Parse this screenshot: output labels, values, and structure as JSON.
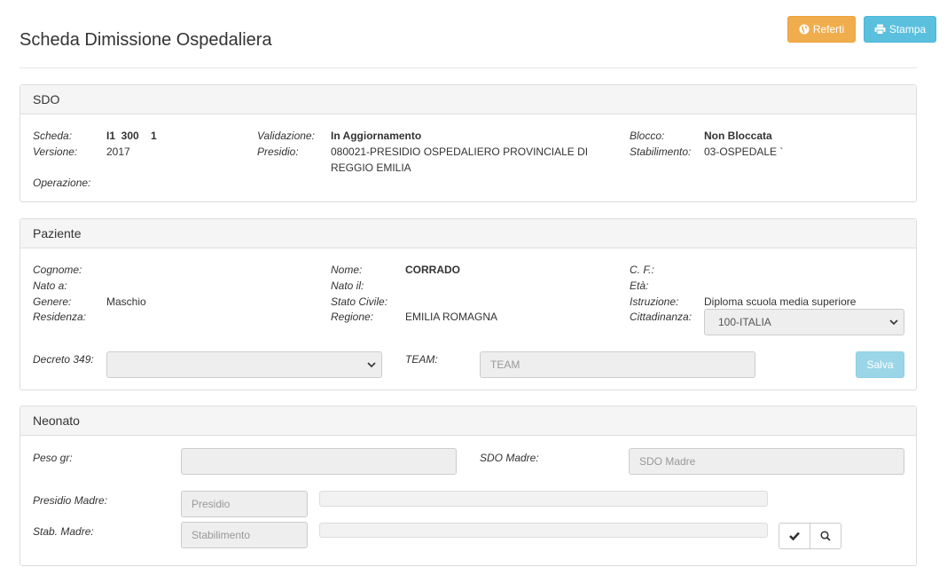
{
  "page": {
    "title": "Scheda Dimissione Ospedaliera"
  },
  "toolbar": {
    "referti_label": "Referti",
    "stampa_label": "Stampa"
  },
  "sdo": {
    "header": "SDO",
    "scheda_label": "Scheda:",
    "scheda_value": "I1  300    1",
    "versione_label": "Versione:",
    "versione_value": "2017",
    "operazione_label": "Operazione:",
    "validazione_label": "Validazione:",
    "validazione_value": "In Aggiornamento",
    "presidio_label": "Presidio:",
    "presidio_value_line1": "080021-PRESIDIO OSPEDALIERO PROVINCIALE DI",
    "presidio_value_line2": "REGGIO EMILIA",
    "blocco_label": "Blocco:",
    "blocco_value": "Non Bloccata",
    "stabilimento_label": "Stabilimento:",
    "stabilimento_value": "03-OSPEDALE `"
  },
  "paziente": {
    "header": "Paziente",
    "cognome_label": "Cognome:",
    "nato_a_label": "Nato a:",
    "genere_label": "Genere:",
    "genere_value": "Maschio",
    "residenza_label": "Residenza:",
    "nome_label": "Nome:",
    "nome_value": "CORRADO",
    "nato_il_label": "Nato il:",
    "stato_civile_label": "Stato Civile:",
    "regione_label": "Regione:",
    "regione_value": "EMILIA ROMAGNA",
    "cf_label": "C. F.:",
    "eta_label": "Età:",
    "istruzione_label": "Istruzione:",
    "istruzione_value": "Diploma scuola media superiore",
    "cittadinanza_label": "Cittadinanza:",
    "cittadinanza_value": "100-ITALIA",
    "decreto_label": "Decreto 349:",
    "decreto_value": "",
    "team_label": "TEAM:",
    "team_placeholder": "TEAM",
    "salva_label": "Salva"
  },
  "neonato": {
    "header": "Neonato",
    "peso_label": "Peso gr:",
    "sdo_madre_label": "SDO Madre:",
    "sdo_madre_placeholder": "SDO Madre",
    "presidio_madre_label": "Presidio Madre:",
    "presidio_placeholder": "Presidio",
    "stab_madre_label": "Stab. Madre:",
    "stabilimento_placeholder": "Stabilimento"
  },
  "icons": {
    "referti": "globe-icon",
    "stampa": "print-icon",
    "confirm": "check-icon",
    "search": "search-icon",
    "dropdown": "chevron-down-icon"
  },
  "colors": {
    "warning": "#f0ad4e",
    "info": "#5bc0de",
    "info_disabled": "#9bd6e8",
    "panel_heading": "#f5f5f5"
  }
}
